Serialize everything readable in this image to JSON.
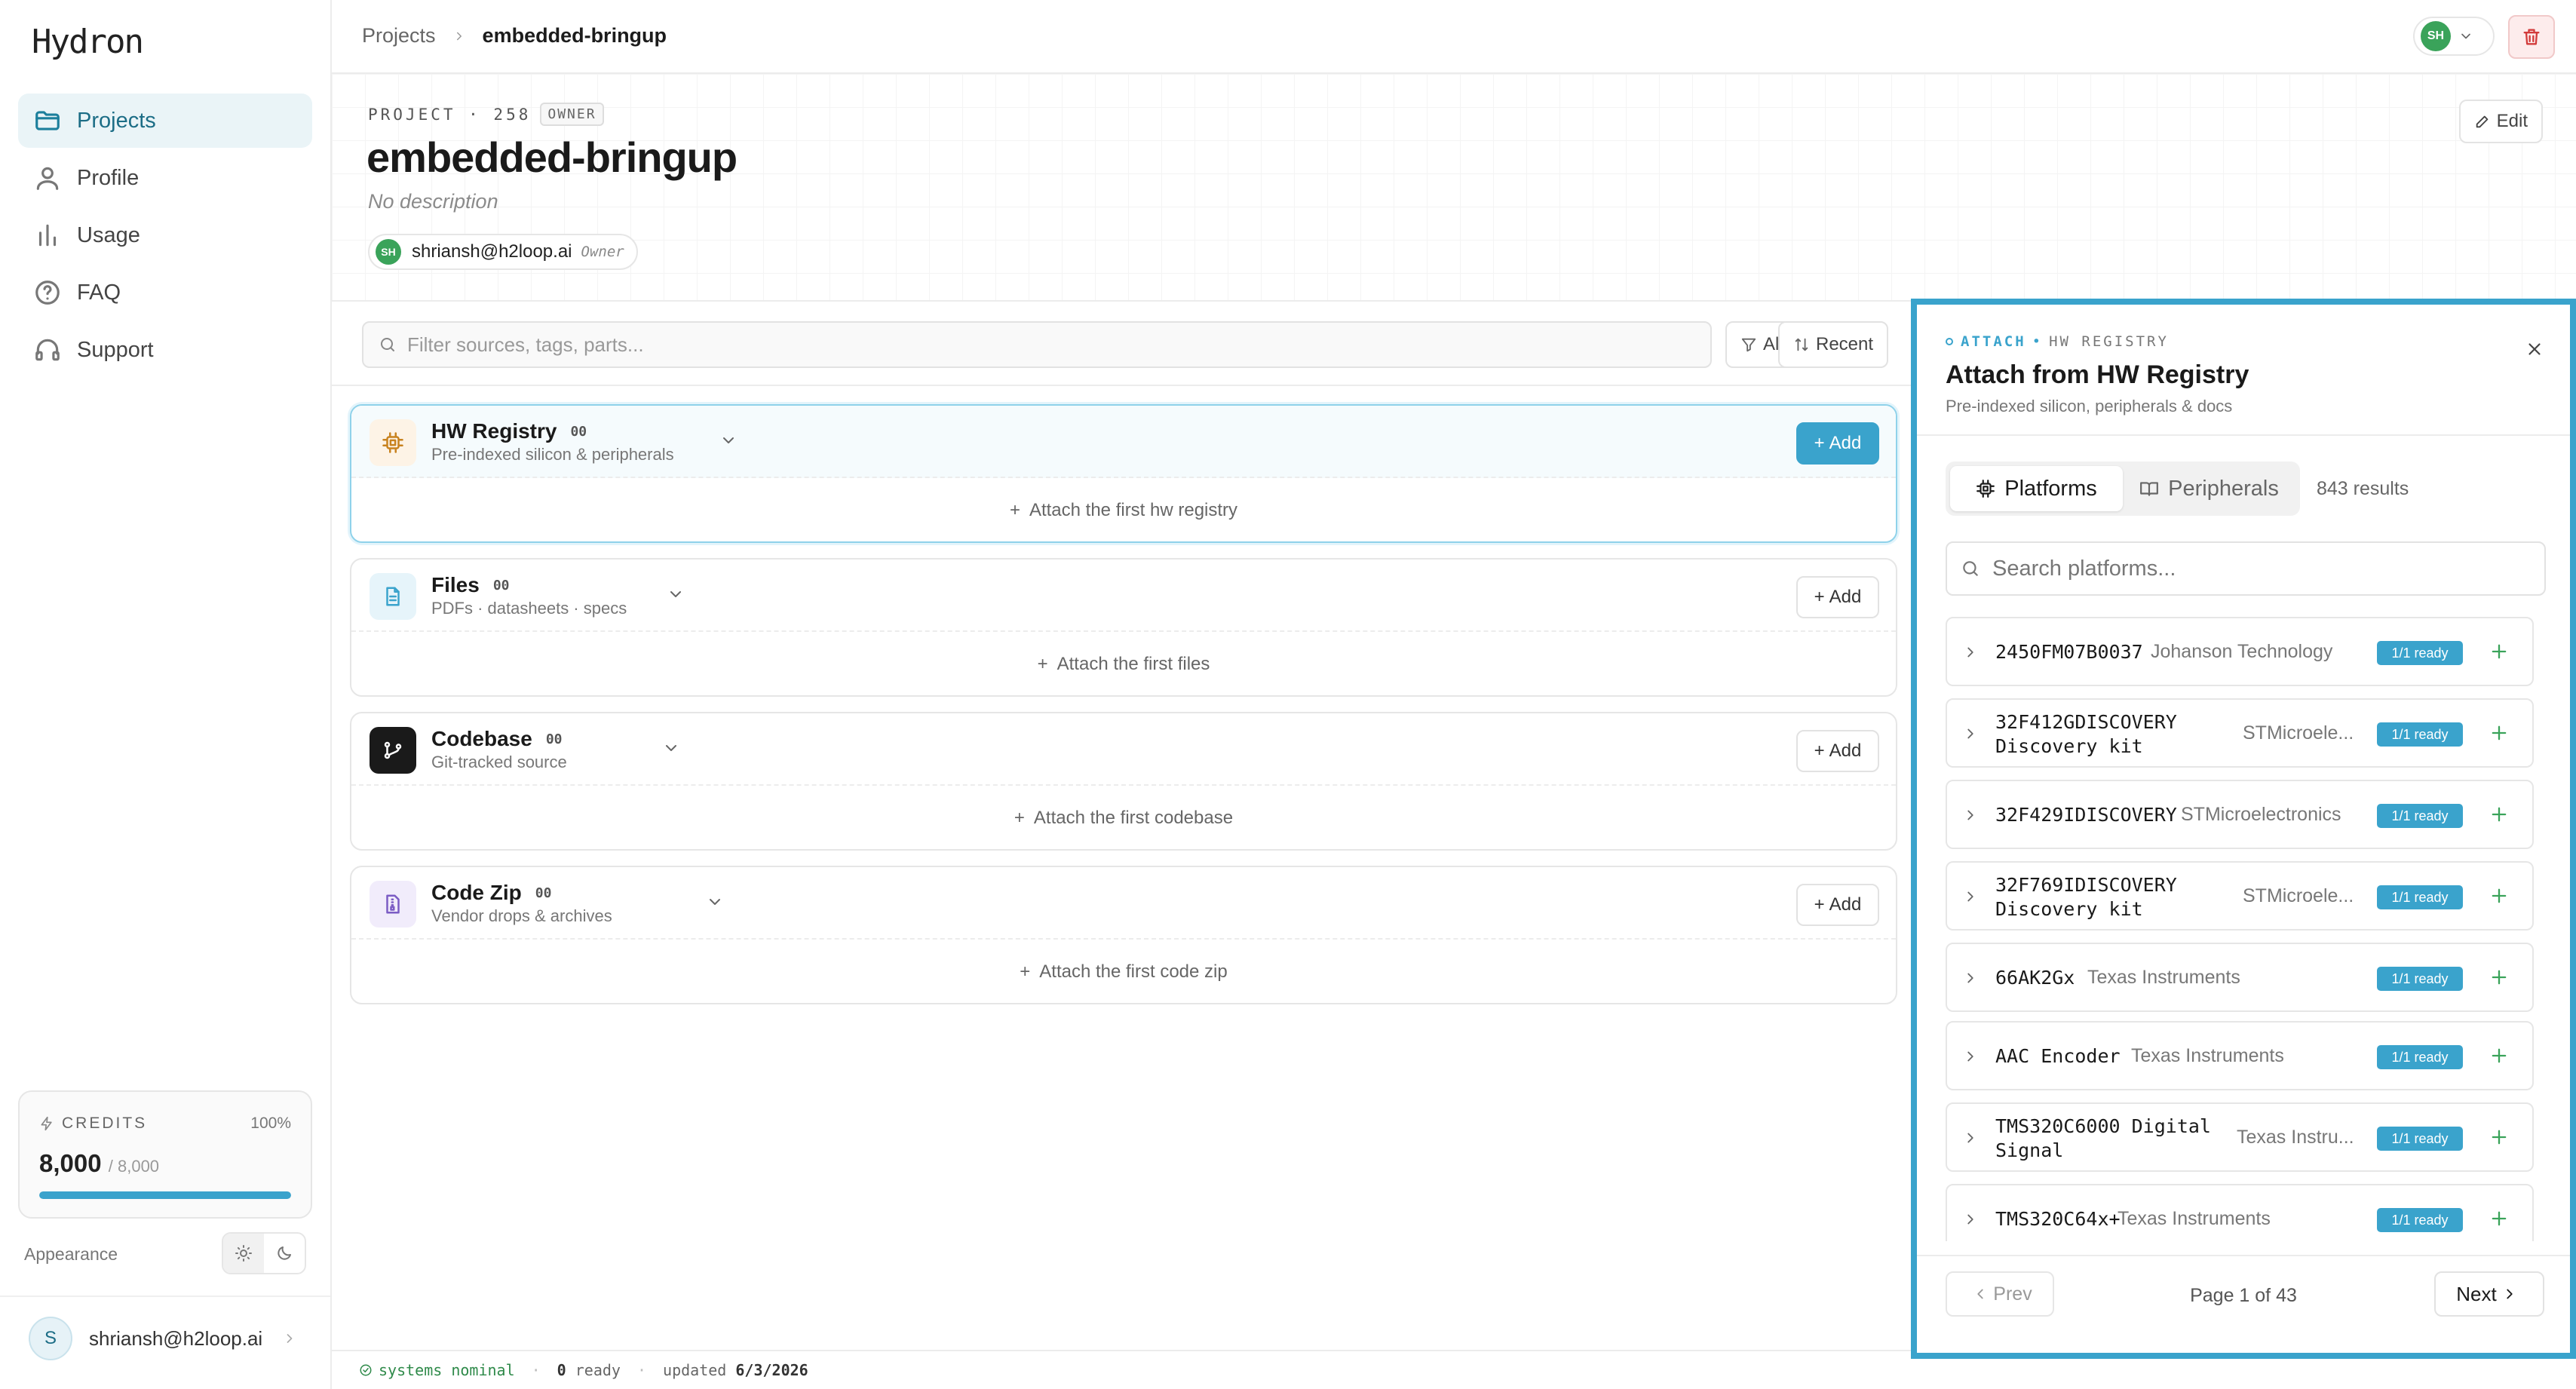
{
  "app": {
    "logo": "Hydron"
  },
  "sidebar": {
    "items": [
      {
        "label": "Projects",
        "icon": "folder-icon"
      },
      {
        "label": "Profile",
        "icon": "user-icon"
      },
      {
        "label": "Usage",
        "icon": "bar-chart-icon"
      },
      {
        "label": "FAQ",
        "icon": "help-circle-icon"
      },
      {
        "label": "Support",
        "icon": "headphones-icon"
      }
    ],
    "credits": {
      "label": "CREDITS",
      "percent": "100%",
      "value": "8,000",
      "total": "/ 8,000",
      "fill_fraction": 1.0
    },
    "appearance_label": "Appearance",
    "user": {
      "initial": "S",
      "email": "shriansh@h2loop.ai"
    }
  },
  "topbar": {
    "breadcrumb": {
      "root": "Projects",
      "current": "embedded-bringup"
    },
    "account_initials": "SH"
  },
  "header": {
    "kicker": "PROJECT · 258",
    "role_badge": "OWNER",
    "title": "embedded-bringup",
    "description": "No description",
    "member": {
      "initials": "SH",
      "email": "shriansh@h2loop.ai",
      "role": "Owner"
    },
    "edit_label": "Edit"
  },
  "filter": {
    "placeholder": "Filter sources, tags, parts...",
    "all_label": "All",
    "recent_label": "Recent"
  },
  "sources": [
    {
      "name": "HW Registry",
      "count": "00",
      "subtitle": "Pre-indexed silicon & peripherals",
      "add": "Add",
      "attach": "Attach the first hw registry"
    },
    {
      "name": "Files",
      "count": "00",
      "subtitle": "PDFs · datasheets · specs",
      "add": "Add",
      "attach": "Attach the first files"
    },
    {
      "name": "Codebase",
      "count": "00",
      "subtitle": "Git-tracked source",
      "add": "Add",
      "attach": "Attach the first codebase"
    },
    {
      "name": "Code Zip",
      "count": "00",
      "subtitle": "Vendor drops & archives",
      "add": "Add",
      "attach": "Attach the first code zip"
    }
  ],
  "status": {
    "ok": "systems nominal",
    "ready_count": "0",
    "ready_label": "ready",
    "updated_label": "updated",
    "updated": "6/3/2026"
  },
  "panel": {
    "kicker_a": "ATTACH",
    "kicker_b": "HW REGISTRY",
    "title": "Attach from HW Registry",
    "subtitle": "Pre-indexed silicon, peripherals & docs",
    "tabs": [
      {
        "label": "Platforms"
      },
      {
        "label": "Peripherals"
      }
    ],
    "results": "843 results",
    "search_placeholder": "Search platforms...",
    "rows": [
      {
        "part": "2450FM07B0037",
        "vendor": "Johanson Technology",
        "status": "1/1 ready"
      },
      {
        "part": "32F412GDISCOVERY Discovery kit",
        "vendor": "STMicroele...",
        "status": "1/1 ready"
      },
      {
        "part": "32F429IDISCOVERY",
        "vendor": "STMicroelectronics",
        "status": "1/1 ready"
      },
      {
        "part": "32F769IDISCOVERY Discovery kit",
        "vendor": "STMicroele...",
        "status": "1/1 ready"
      },
      {
        "part": "66AK2Gx",
        "vendor": "Texas Instruments",
        "status": "1/1 ready"
      },
      {
        "part": "AAC Encoder",
        "vendor": "Texas Instruments",
        "status": "1/1 ready"
      },
      {
        "part": "TMS320C6000 Digital Signal",
        "vendor": "Texas Instru...",
        "status": "1/1 ready"
      },
      {
        "part": "TMS320C64x+",
        "vendor": "Texas Instruments",
        "status": "1/1 ready"
      }
    ],
    "pager": {
      "prev": "Prev",
      "info": "Page 1 of 43",
      "next": "Next"
    }
  },
  "colors": {
    "accent": "#3aa3cc",
    "ok": "#2f8a4a",
    "danger": "#d23b3b"
  }
}
